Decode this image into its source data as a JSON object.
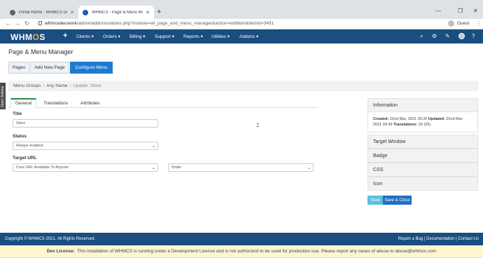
{
  "browser": {
    "tabs": [
      {
        "title": "Portal Home - WHMCS Dev Two"
      },
      {
        "title": "WHMCS - Page & Menu Manager"
      }
    ],
    "new_tab_symbol": "+",
    "url_host": "whmcsdev.work",
    "url_path": "/admin/addonmodules.php?module=wl_page_and_menu_manager&action=edititem&itemid=3491",
    "profile_label": "Guest"
  },
  "nav": {
    "logo_prefix": "WHM",
    "logo_o": "O",
    "logo_suffix": "S",
    "plus": "+",
    "menus": [
      "Clients ▾",
      "Orders ▾",
      "Billing ▾",
      "Support ▾",
      "Reports ▾",
      "Utilities ▾",
      "Addons ▾"
    ],
    "icons": [
      "search-icon",
      "cogs-icon",
      "wrench-icon",
      "avatar",
      "help-icon"
    ]
  },
  "page": {
    "title": "Page & Menu Manager",
    "buttons": {
      "pages": "Pages",
      "add_new_page": "Add New Page",
      "configure_menu": "Configure Menu"
    },
    "breadcrumb": {
      "menu_groups": "Menu Groups",
      "any_name": "Any Name",
      "current": "Update: Store",
      "sep": "/"
    },
    "sidebar_tab": "Open Sidebar",
    "tabs": {
      "general": "General",
      "translations": "Translations",
      "attributes": "Attributes"
    },
    "form": {
      "title_label": "Title",
      "title_value": "Store",
      "status_label": "Status",
      "status_value": "Always enabled",
      "target_url_label": "Target URL",
      "target_url_value": "Core URL Available To Anyone",
      "order_value": "Order"
    }
  },
  "panel": {
    "information": "Information",
    "created_label": "Created:",
    "created_value": "22nd Mar, 2021 09:20",
    "updated_label": "Updated:",
    "updated_value": "22nd Mar, 2021 09:49",
    "translations_label": "Translations:",
    "translations_value": "26 (25)",
    "target_window": "Target Window",
    "badge": "Badge",
    "css": "CSS",
    "icon": "Icon"
  },
  "actions": {
    "save": "Save",
    "save_close": "Save & Close"
  },
  "footer": {
    "copyright": "Copyright © WHMCS 2021. All Rights Reserved.",
    "report_bug": "Report a Bug",
    "documentation": "Documentation",
    "contact": "Contact Us",
    "sep": "|"
  },
  "devbar": {
    "label": "Dev License:",
    "text": "This installation of WHMCS is running under a Development License and is not authorized to be used for production use. Please report any cases of abuse to abuse@whmcs.com"
  },
  "colors": {
    "navbar": "#1a4d80",
    "primary": "#1e7ad2",
    "save": "#5bc0de",
    "dev_bar": "#fdf6d1"
  }
}
